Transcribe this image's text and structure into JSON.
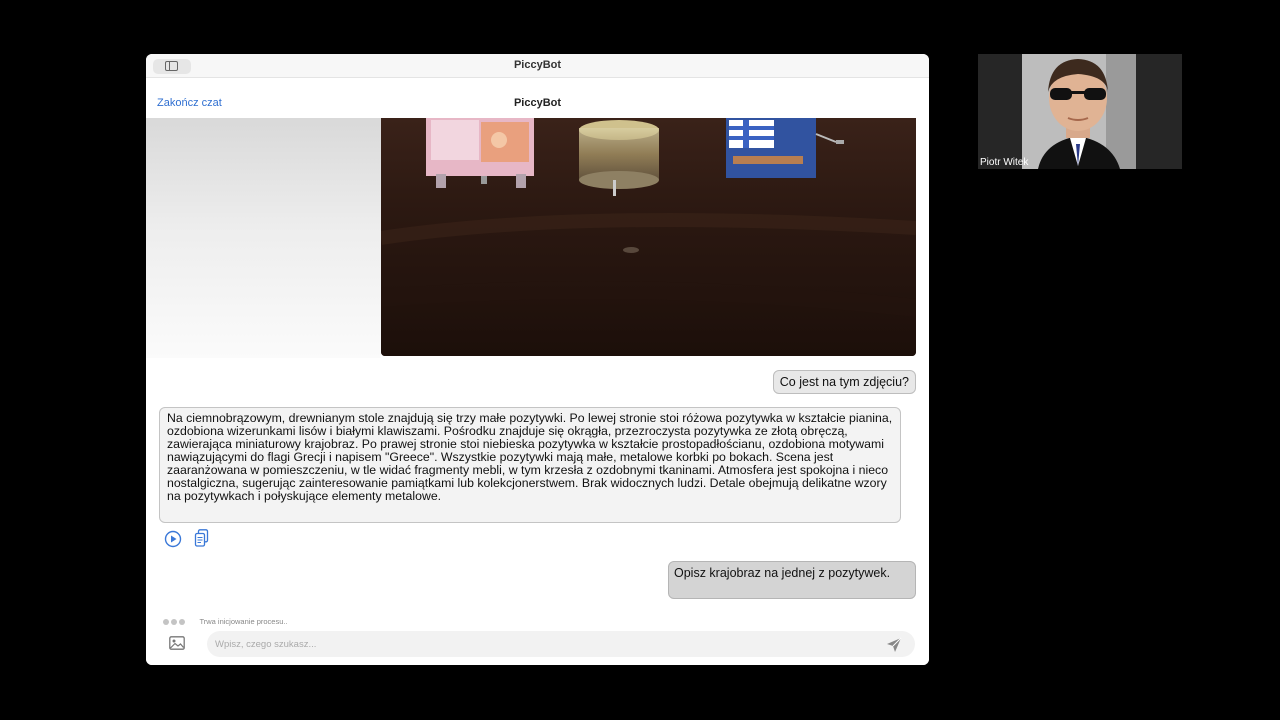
{
  "window": {
    "title": "PiccyBot"
  },
  "navbar": {
    "end_chat_label": "Zakończ czat",
    "title": "PiccyBot"
  },
  "chat": {
    "user_message_1": "Co jest na tym zdjęciu?",
    "bot_message": "Na ciemnobrązowym, drewnianym stole znajdują się trzy małe pozytywki. Po lewej stronie stoi różowa pozytywka w kształcie pianina, ozdobiona wizerunkami lisów i białymi klawiszami. Pośrodku znajduje się okrągła, przezroczysta pozytywka ze złotą obręczą, zawierająca miniaturowy krajobraz. Po prawej stronie stoi niebieska pozytywka w kształcie prostopadłościanu, ozdobiona motywami nawiązującymi do flagi Grecji i napisem \"Greece\". Wszystkie pozytywki mają małe, metalowe korbki po bokach. Scena jest zaaranżowana w pomieszczeniu, w tle widać fragmenty mebli, w tym krzesła z ozdobnymi tkaninami. Atmosfera jest spokojna i nieco nostalgiczna, sugerując zainteresowanie pamiątkami lub kolekcjonerstwem. Brak widocznych ludzi. Detale obejmują delikatne wzory na pozytywkach i połyskujące elementy metalowe.",
    "user_message_2": "Opisz krajobraz na jednej z pozytywek.",
    "status_text": "Trwa inicjowanie procesu..",
    "icons": {
      "play": "play-icon",
      "copy": "copy-icon",
      "image": "image-icon",
      "send": "send-icon"
    }
  },
  "input": {
    "placeholder": "Wpisz, czego szukasz..."
  },
  "participant": {
    "name": "Piotr Witek"
  },
  "colors": {
    "accent": "#2f6fd1",
    "background": "#000000"
  }
}
